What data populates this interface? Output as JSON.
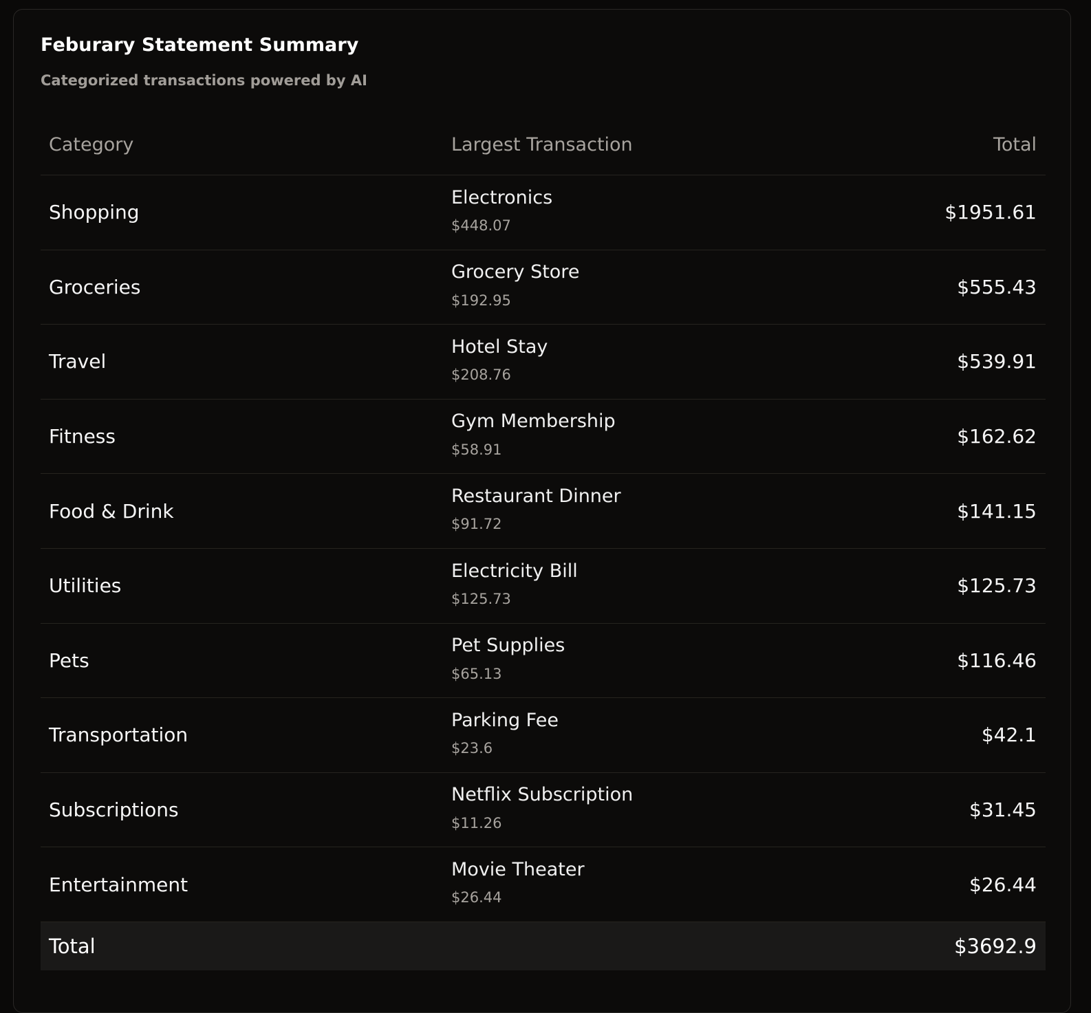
{
  "card": {
    "title": "Feburary Statement Summary",
    "subtitle": "Categorized transactions powered by AI"
  },
  "table": {
    "headers": {
      "category": "Category",
      "largest": "Largest Transaction",
      "total": "Total"
    },
    "rows": [
      {
        "category": "Shopping",
        "tx_name": "Electronics",
        "tx_amount": "$448.07",
        "total": "$1951.61"
      },
      {
        "category": "Groceries",
        "tx_name": "Grocery Store",
        "tx_amount": "$192.95",
        "total": "$555.43"
      },
      {
        "category": "Travel",
        "tx_name": "Hotel Stay",
        "tx_amount": "$208.76",
        "total": "$539.91"
      },
      {
        "category": "Fitness",
        "tx_name": "Gym Membership",
        "tx_amount": "$58.91",
        "total": "$162.62"
      },
      {
        "category": "Food & Drink",
        "tx_name": "Restaurant Dinner",
        "tx_amount": "$91.72",
        "total": "$141.15"
      },
      {
        "category": "Utilities",
        "tx_name": "Electricity Bill",
        "tx_amount": "$125.73",
        "total": "$125.73"
      },
      {
        "category": "Pets",
        "tx_name": "Pet Supplies",
        "tx_amount": "$65.13",
        "total": "$116.46"
      },
      {
        "category": "Transportation",
        "tx_name": "Parking Fee",
        "tx_amount": "$23.6",
        "total": "$42.1"
      },
      {
        "category": "Subscriptions",
        "tx_name": "Netflix Subscription",
        "tx_amount": "$11.26",
        "total": "$31.45"
      },
      {
        "category": "Entertainment",
        "tx_name": "Movie Theater",
        "tx_amount": "$26.44",
        "total": "$26.44"
      }
    ],
    "footer": {
      "label": "Total",
      "total": "$3692.9"
    }
  }
}
